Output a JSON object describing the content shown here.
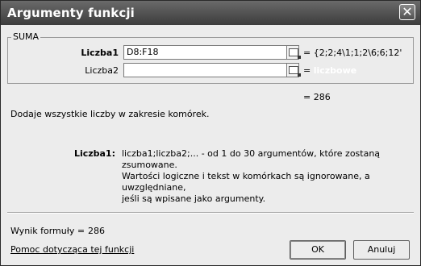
{
  "window": {
    "title": "Argumenty funkcji",
    "close_glyph": "✕"
  },
  "function_group": {
    "name": "SUMA",
    "args": [
      {
        "label": "Liczba1",
        "value": "D8:F18",
        "result": "= {2;2;4\\1;1;2\\6;6;12'"
      },
      {
        "label": "Liczba2",
        "value": "",
        "result_prefix": "=",
        "result_hint": "liczbowe"
      }
    ]
  },
  "total_result": "= 286",
  "description": "Dodaje wszystkie liczby w zakresie komórek.",
  "arg_help": {
    "label": "Liczba1:",
    "lines": [
      "liczba1;liczba2;... - od 1 do 30 argumentów, które zostaną zsumowane.",
      "Wartości logiczne i tekst w komórkach są ignorowane, a uwzględniane,",
      "jeśli są wpisane jako argumenty."
    ]
  },
  "formula_result": {
    "label": "Wynik formuły =",
    "value": "286"
  },
  "help_link": "Pomoc dotycząca tej funkcji",
  "buttons": {
    "ok": "OK",
    "cancel": "Anuluj"
  },
  "icons": {
    "close": "close-icon",
    "range_picker": "collapse-dialog-icon"
  }
}
